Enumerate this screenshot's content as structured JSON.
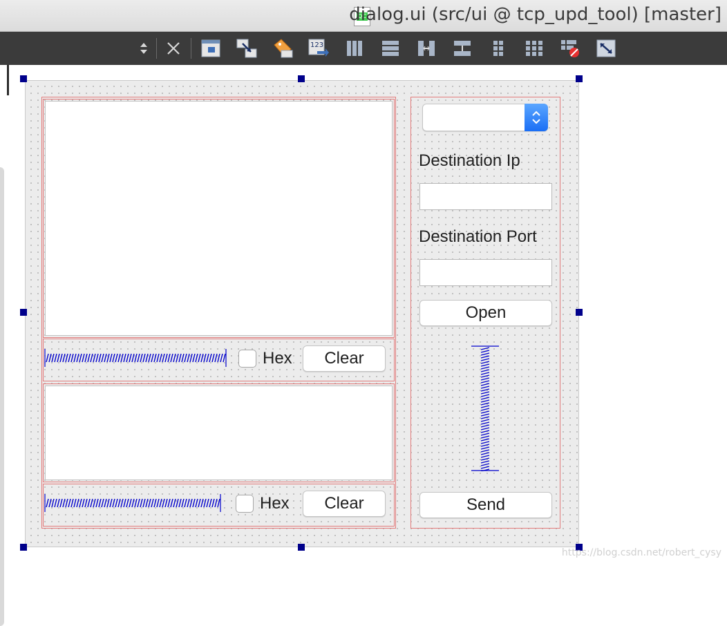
{
  "window": {
    "title": "dialog.ui (src/ui @ tcp_upd_tool) [master]",
    "doc_icon_badge": "QC"
  },
  "toolbar": {
    "items": [
      {
        "icon": "sort-updown-icon"
      },
      {
        "icon": "close-icon"
      },
      {
        "icon": "edit-widgets-icon"
      },
      {
        "icon": "edit-signals-slots-icon"
      },
      {
        "icon": "edit-buddies-icon"
      },
      {
        "icon": "edit-tab-order-icon"
      },
      {
        "icon": "layout-horizontal-icon"
      },
      {
        "icon": "layout-vertical-icon"
      },
      {
        "icon": "layout-horizontal-splitter-icon"
      },
      {
        "icon": "layout-vertical-splitter-icon"
      },
      {
        "icon": "layout-form-icon"
      },
      {
        "icon": "layout-grid-icon"
      },
      {
        "icon": "break-layout-icon"
      },
      {
        "icon": "adjust-size-icon"
      }
    ]
  },
  "form": {
    "receive_panel": {
      "hex_label": "Hex",
      "hex_checked": false,
      "clear_label": "Clear"
    },
    "send_panel": {
      "hex_label": "Hex",
      "hex_checked": false,
      "clear_label": "Clear"
    },
    "right_panel": {
      "combo_value": "",
      "destination_ip_label": "Destination Ip",
      "destination_ip_value": "",
      "destination_port_label": "Destination Port",
      "destination_port_value": "",
      "open_label": "Open",
      "send_label": "Send"
    }
  },
  "watermark": "https://blog.csdn.net/robert_cysy",
  "colors": {
    "toolbar_bg": "#3b3b3b",
    "form_bg": "#ececec",
    "layout_border": "#e27b7b",
    "selection_handle": "#00008b",
    "spacer": "#0000cc",
    "combo_arrow": "#1a6ef5"
  }
}
